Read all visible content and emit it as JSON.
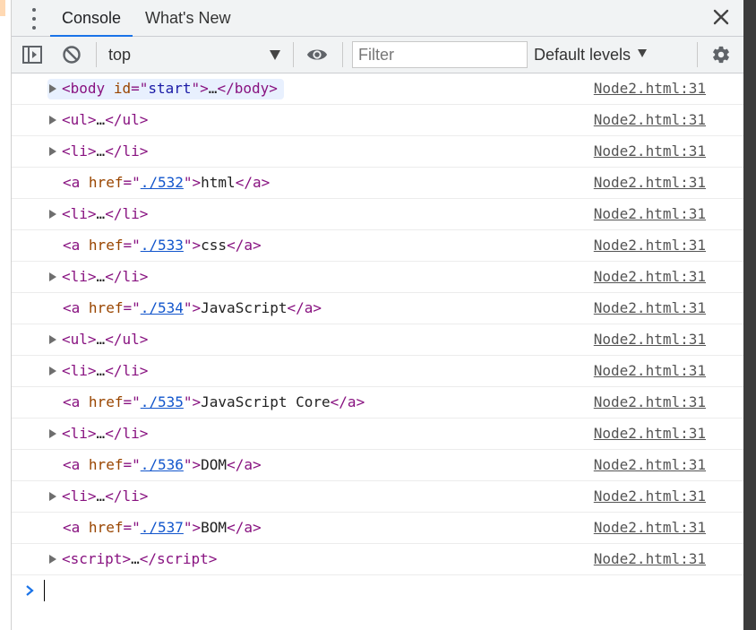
{
  "tabs": {
    "console": "Console",
    "whats_new": "What's New"
  },
  "toolbar": {
    "context": "top",
    "filter_placeholder": "Filter",
    "levels": "Default levels"
  },
  "colors": {
    "tag": "#881280",
    "attr_name": "#994500",
    "attr_value": "#1a1aa6",
    "link": "#1155cc",
    "accent": "#1a73e8"
  },
  "messages": [
    {
      "source": "Node2.html:31",
      "kind": "tag",
      "tag": "body",
      "attr": "id",
      "value": "start",
      "ellipsis": "…",
      "expandable": true,
      "highlight": true
    },
    {
      "source": "Node2.html:31",
      "kind": "tag",
      "tag": "ul",
      "ellipsis": "…",
      "expandable": true
    },
    {
      "source": "Node2.html:31",
      "kind": "tag",
      "tag": "li",
      "ellipsis": "…",
      "expandable": true
    },
    {
      "source": "Node2.html:31",
      "kind": "link",
      "tag": "a",
      "attr": "href",
      "href": "./532",
      "text": "html"
    },
    {
      "source": "Node2.html:31",
      "kind": "tag",
      "tag": "li",
      "ellipsis": "…",
      "expandable": true
    },
    {
      "source": "Node2.html:31",
      "kind": "link",
      "tag": "a",
      "attr": "href",
      "href": "./533",
      "text": "css"
    },
    {
      "source": "Node2.html:31",
      "kind": "tag",
      "tag": "li",
      "ellipsis": "…",
      "expandable": true
    },
    {
      "source": "Node2.html:31",
      "kind": "link",
      "tag": "a",
      "attr": "href",
      "href": "./534",
      "text": "JavaScript"
    },
    {
      "source": "Node2.html:31",
      "kind": "tag",
      "tag": "ul",
      "ellipsis": "…",
      "expandable": true
    },
    {
      "source": "Node2.html:31",
      "kind": "tag",
      "tag": "li",
      "ellipsis": "…",
      "expandable": true
    },
    {
      "source": "Node2.html:31",
      "kind": "link",
      "tag": "a",
      "attr": "href",
      "href": "./535",
      "text": "JavaScript Core"
    },
    {
      "source": "Node2.html:31",
      "kind": "tag",
      "tag": "li",
      "ellipsis": "…",
      "expandable": true
    },
    {
      "source": "Node2.html:31",
      "kind": "link",
      "tag": "a",
      "attr": "href",
      "href": "./536",
      "text": "DOM"
    },
    {
      "source": "Node2.html:31",
      "kind": "tag",
      "tag": "li",
      "ellipsis": "…",
      "expandable": true
    },
    {
      "source": "Node2.html:31",
      "kind": "link",
      "tag": "a",
      "attr": "href",
      "href": "./537",
      "text": "BOM"
    },
    {
      "source": "Node2.html:31",
      "kind": "tag",
      "tag": "script",
      "ellipsis": "…",
      "expandable": true
    }
  ],
  "icons": {
    "menu": "kebab-menu-icon",
    "close": "close-icon",
    "sidebar": "sidebar-toggle-icon",
    "clear": "clear-console-icon",
    "eye": "eye-icon",
    "settings": "gear-icon",
    "prompt": "chevron-right-icon"
  }
}
